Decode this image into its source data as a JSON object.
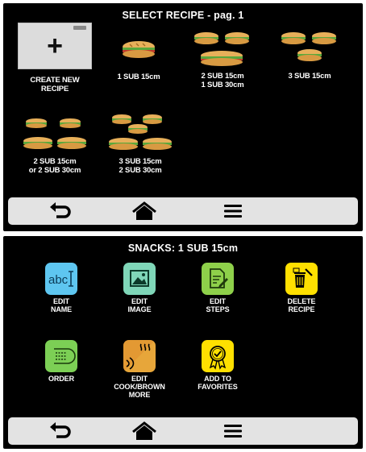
{
  "screen1": {
    "title": "SELECT RECIPE - pag. 1",
    "tiles": [
      {
        "line1": "CREATE NEW",
        "line2": "RECIPE"
      },
      {
        "line1": "1 SUB 15cm",
        "line2": ""
      },
      {
        "line1": "2 SUB 15cm",
        "line2": "1 SUB 30cm"
      },
      {
        "line1": "3 SUB 15cm",
        "line2": ""
      },
      {
        "line1": "2 SUB 15cm",
        "line2": "or 2 SUB 30cm"
      },
      {
        "line1": "3 SUB 15cm",
        "line2": "2 SUB 30cm"
      }
    ]
  },
  "screen2": {
    "title": "SNACKS: 1 SUB 15cm",
    "items": [
      {
        "line1": "EDIT",
        "line2": "NAME",
        "line3": "",
        "color": "#5ec6f0",
        "icon": "text-cursor-icon"
      },
      {
        "line1": "EDIT",
        "line2": "IMAGE",
        "line3": "",
        "color": "#7fd6b8",
        "icon": "image-icon"
      },
      {
        "line1": "EDIT",
        "line2": "STEPS",
        "line3": "",
        "color": "#8ed04a",
        "icon": "edit-document-icon"
      },
      {
        "line1": "DELETE",
        "line2": "RECIPE",
        "line3": "",
        "color": "#ffe000",
        "icon": "trash-icon"
      },
      {
        "line1": "ORDER",
        "line2": "",
        "line3": "",
        "color": "#7ccf55",
        "icon": "list-order-icon"
      },
      {
        "line1": "EDIT",
        "line2": "COOK/BROWN",
        "line3": "MORE",
        "color": "#f08a1e",
        "icon": "cook-brown-icon"
      },
      {
        "line1": "ADD TO",
        "line2": "FAVORITES",
        "line3": "",
        "color": "#ffe000",
        "icon": "award-ribbon-icon"
      }
    ]
  },
  "navbar": {
    "icons": [
      "back-arrow-icon",
      "home-icon",
      "menu-icon"
    ]
  }
}
